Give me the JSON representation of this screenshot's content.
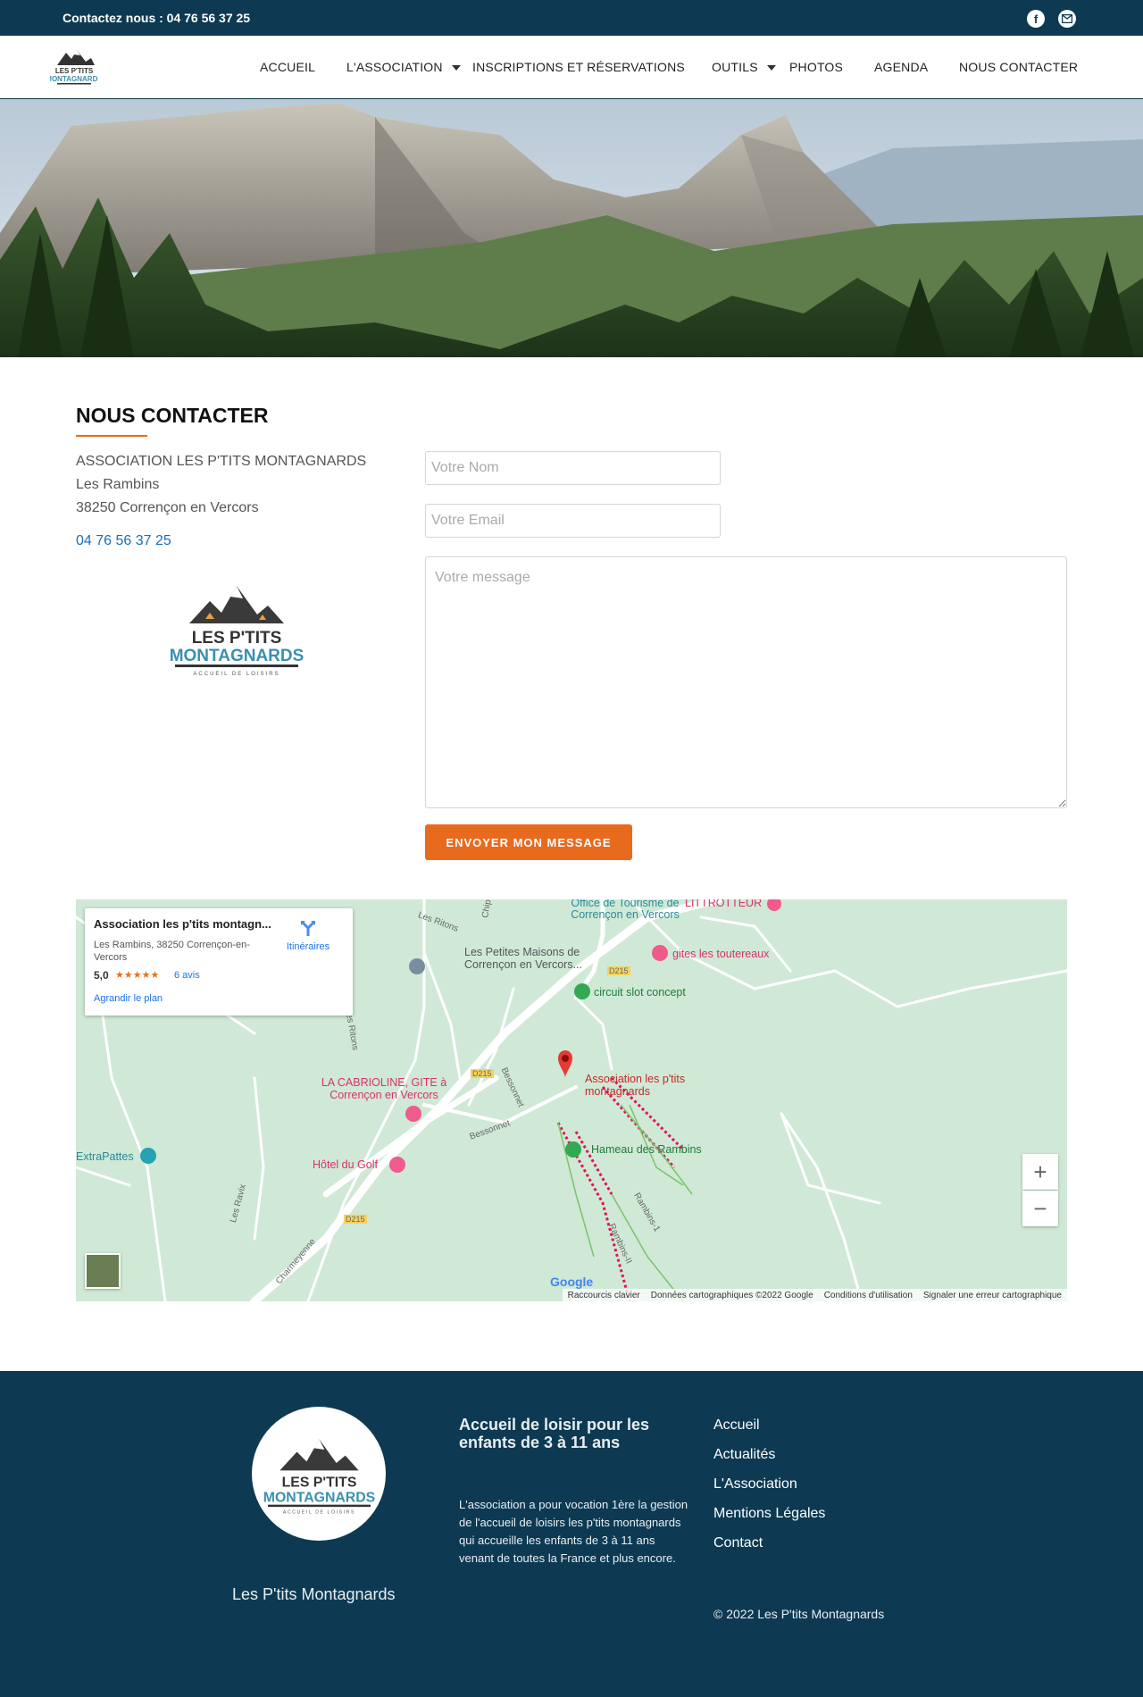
{
  "topbar": {
    "contact": "Contactez nous : 04 76 56 37 25",
    "facebook_icon": "facebook-icon",
    "email_icon": "email-icon"
  },
  "nav": {
    "items": [
      {
        "label": "ACCUEIL"
      },
      {
        "label": "L'ASSOCIATION"
      },
      {
        "label": "INSCRIPTIONS ET RÉSERVATIONS"
      },
      {
        "label": "OUTILS"
      },
      {
        "label": "PHOTOS"
      },
      {
        "label": "AGENDA"
      },
      {
        "label": "NOUS CONTACTER"
      }
    ]
  },
  "logo": {
    "line1": "LES P'TITS",
    "line2": "MONTAGNARDS",
    "line3": "ACCUEIL DE LOISIRS"
  },
  "contact": {
    "title": "NOUS CONTACTER",
    "org": "ASSOCIATION LES P'TITS MONTAGNARDS",
    "street": "Les Rambins",
    "city": "38250 Corrençon en Vercors",
    "phone": "04 76 56 37 25"
  },
  "form": {
    "name_placeholder": "Votre Nom",
    "email_placeholder": "Votre Email",
    "message_placeholder": "Votre message",
    "submit_label": "ENVOYER MON MESSAGE"
  },
  "map": {
    "card": {
      "name": "Association les p'tits montagn...",
      "address": "Les Rambins, 38250 Corrençon-en-Vercors",
      "rating": "5,0",
      "stars": "★★★★★",
      "reviews": "6 avis",
      "enlarge": "Agrandir le plan",
      "directions": "Itinéraires"
    },
    "labels": {
      "office": "Office de Tourisme de Corrençon en Vercors",
      "littrotteur": "LITTROTTEUR",
      "petites_maisons": "Les Petites Maisons de Corrençon en Vercors...",
      "gites": "gites les toutereaux",
      "circuit": "circuit slot concept",
      "assoc": "Association les p'tits montagnards",
      "cabrioline": "LA CABRIOLINE, GITE à Corrençon en Vercors",
      "hotel": "Hôtel du Golf",
      "hameau": "Hameau des Rambins",
      "extrapattes": "ExtraPattes"
    },
    "roads": {
      "ritons1": "Les Ritons",
      "ritons2": "Les Ritons",
      "chip": "Chip",
      "d215a": "D215",
      "d215b": "D215",
      "d215c": "D215",
      "bessonnet1": "Bessonnet",
      "bessonnet2": "Bessonnet",
      "ravix": "Les Ravix",
      "charmeyenne": "Charmeyenne",
      "rambins1": "Rambins-1",
      "rambins2": "Rambins-II"
    },
    "zoom_in": "+",
    "zoom_out": "−",
    "google": "Google",
    "footer": {
      "shortcuts": "Raccourcis clavier",
      "data": "Données cartographiques ©2022 Google",
      "terms": "Conditions d'utilisation",
      "report": "Signaler une erreur cartographique"
    }
  },
  "footer": {
    "name": "Les P'tits Montagnards",
    "tagline": "Accueil de loisir pour les enfants de 3 à 11 ans",
    "description": "L'association a pour vocation 1ère la gestion de l'accueil de loisirs les p'tits montagnards qui accueille les enfants de 3 à 11 ans venant de toutes la France et plus encore.",
    "links": [
      {
        "label": "Accueil"
      },
      {
        "label": "Actualités"
      },
      {
        "label": "L'Association"
      },
      {
        "label": "Mentions Légales"
      },
      {
        "label": "Contact"
      }
    ],
    "copyright": "© 2022 Les P'tits Montagnards"
  },
  "colors": {
    "navy": "#0d3a52",
    "orange": "#e86a1f",
    "link_blue": "#1a6fb8",
    "map_green": "#cfe9d6"
  }
}
